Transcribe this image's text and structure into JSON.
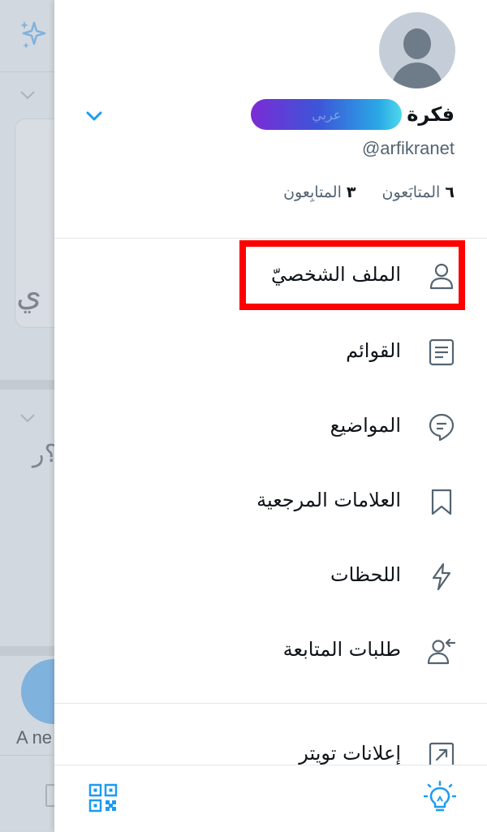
{
  "background": {
    "bottom_text": "A ne"
  },
  "drawer": {
    "display_name": "فكرة",
    "name_badge_text": "عربي",
    "handle": "@arfikranet",
    "stats": {
      "following_count": "٦",
      "following_label": "المتابَعون",
      "followers_count": "٣",
      "followers_label": "المتابِعون"
    },
    "menu": [
      {
        "label": "الملف الشخصيّ",
        "icon": "person-icon",
        "highlighted": true
      },
      {
        "label": "القوائم",
        "icon": "list-icon"
      },
      {
        "label": "المواضيع",
        "icon": "topics-icon"
      },
      {
        "label": "العلامات المرجعية",
        "icon": "bookmark-icon"
      },
      {
        "label": "اللحظات",
        "icon": "lightning-icon"
      },
      {
        "label": "طلبات المتابعة",
        "icon": "follow-request-icon"
      }
    ],
    "secondary_menu": [
      {
        "label": "إعلانات تويتر",
        "icon": "external-link-icon"
      }
    ],
    "bottom_bar": {
      "left_icon": "qr-code-icon",
      "right_icon": "lightbulb-icon"
    }
  },
  "colors": {
    "accent": "#1d9bf0",
    "highlight": "#ff0000",
    "text_primary": "#0f1419",
    "text_secondary": "#536471"
  }
}
